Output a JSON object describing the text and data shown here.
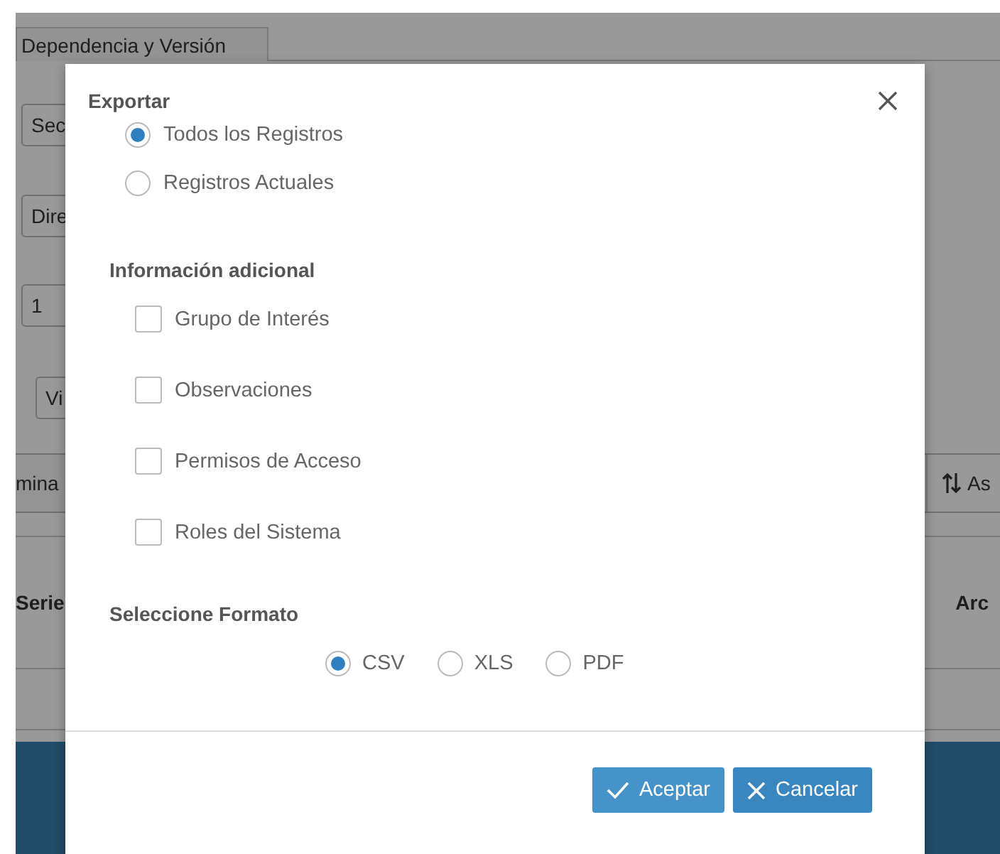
{
  "background": {
    "tab": "Dependencia y Versión",
    "fields": [
      {
        "value": "Sec"
      },
      {
        "value": "Dire"
      },
      {
        "value": "1"
      },
      {
        "value": "Vi"
      }
    ],
    "toolbar": {
      "left_text": "mina",
      "sort_button": "As"
    },
    "table": {
      "columns": [
        "Serie",
        "Arc"
      ]
    }
  },
  "dialog": {
    "title": "Exportar",
    "scope_options": [
      {
        "label": "Todos los Registros",
        "selected": true
      },
      {
        "label": "Registros Actuales",
        "selected": false
      }
    ],
    "additional": {
      "heading": "Información adicional",
      "options": [
        {
          "label": "Grupo de Interés",
          "checked": false
        },
        {
          "label": "Observaciones",
          "checked": false
        },
        {
          "label": "Permisos de Acceso",
          "checked": false
        },
        {
          "label": "Roles del Sistema",
          "checked": false
        }
      ]
    },
    "format": {
      "heading": "Seleccione Formato",
      "options": [
        {
          "label": "CSV",
          "selected": true
        },
        {
          "label": "XLS",
          "selected": false
        },
        {
          "label": "PDF",
          "selected": false
        }
      ]
    },
    "buttons": [
      {
        "label": "Aceptar",
        "kind": "accept"
      },
      {
        "label": "Cancelar",
        "kind": "cancel"
      }
    ]
  }
}
